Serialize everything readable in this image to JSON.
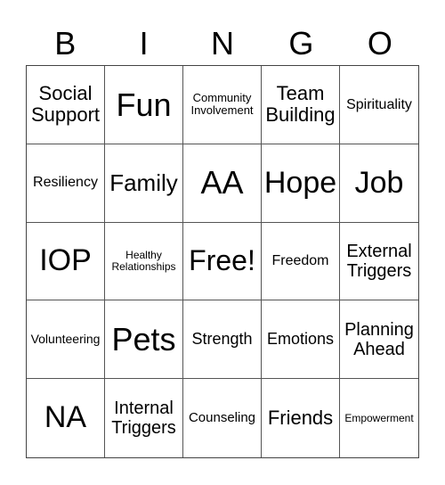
{
  "header": [
    "B",
    "I",
    "N",
    "G",
    "O"
  ],
  "cells": [
    "Social Support",
    "Fun",
    "Community Involvement",
    "Team Building",
    "Spirituality",
    "Resiliency",
    "Family",
    "AA",
    "Hope",
    "Job",
    "IOP",
    "Healthy Relationships",
    "Free!",
    "Freedom",
    "External Triggers",
    "Volunteering",
    "Pets",
    "Strength",
    "Emotions",
    "Planning Ahead",
    "NA",
    "Internal Triggers",
    "Counseling",
    "Friends",
    "Empowerment"
  ]
}
